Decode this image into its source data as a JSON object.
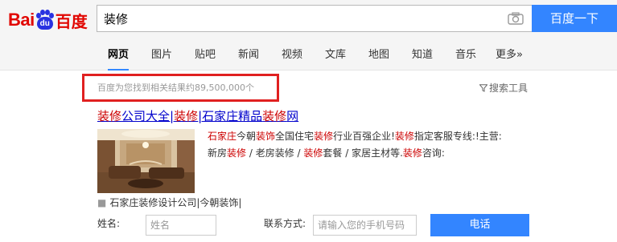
{
  "logo": {
    "left": "Bai",
    "paw": "du",
    "right": "百度"
  },
  "search": {
    "query": "装修",
    "button_label": "百度一下"
  },
  "tabs": [
    {
      "label": "网页",
      "active": true
    },
    {
      "label": "图片"
    },
    {
      "label": "贴吧"
    },
    {
      "label": "新闻"
    },
    {
      "label": "视频"
    },
    {
      "label": "文库"
    },
    {
      "label": "地图"
    },
    {
      "label": "知道"
    },
    {
      "label": "音乐"
    },
    {
      "label": "更多»"
    }
  ],
  "stats": "百度为您找到相关结果约89,500,000个",
  "tools_label": "搜索工具",
  "result": {
    "title_parts": [
      "装修",
      "公司大全|",
      "装修",
      "|石家庄精品",
      "装修",
      "网"
    ],
    "desc_line1": [
      "石家庄",
      "今朝",
      "装饰",
      "全国住宅",
      "装修",
      "行业百强企业!",
      "装修",
      "指定客服专线:!主营:"
    ],
    "desc_line2": [
      "新房",
      "装修",
      " / 老房装修 / ",
      "装修",
      "套餐 / 家居主材等.",
      "装修",
      "咨询:"
    ],
    "sub_link": "石家庄装修设计公司|今朝装饰|",
    "form": {
      "name_label": "姓名:",
      "name_placeholder": "姓名",
      "phone_label": "联系方式:",
      "phone_placeholder": "请输入您的手机号码",
      "submit_label": "电话"
    }
  },
  "colors": {
    "brand_red": "#e10601",
    "brand_blue": "#2932e1",
    "accent": "#3385ff",
    "link": "#0000cc",
    "highlight": "#cc0000",
    "annotation_red": "#e02020"
  }
}
